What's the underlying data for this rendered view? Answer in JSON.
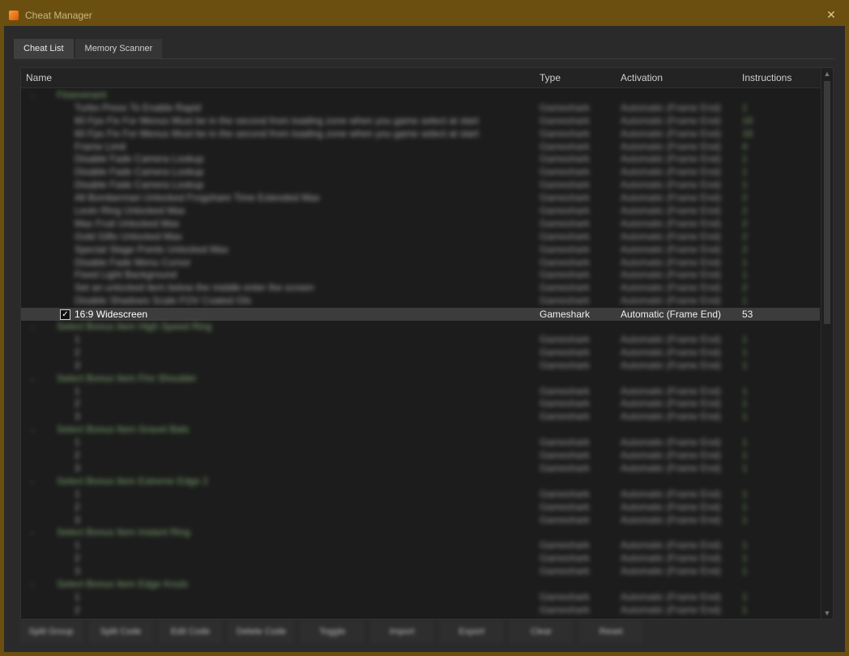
{
  "window": {
    "title": "Cheat Manager"
  },
  "tabs": [
    {
      "label": "Cheat List",
      "active": true
    },
    {
      "label": "Memory Scanner",
      "active": false
    }
  ],
  "columns": {
    "name": "Name",
    "type": "Type",
    "activation": "Activation",
    "instructions": "Instructions"
  },
  "rows": [
    {
      "kind": "group",
      "name": "Flowvenant",
      "type": "",
      "activation": "",
      "instructions": ""
    },
    {
      "kind": "item",
      "name": "Turbo Press To Enable Rapid",
      "type": "Gameshark",
      "activation": "Automatic (Frame End)",
      "instructions": "1"
    },
    {
      "kind": "item",
      "name": "60 Fps Fix For Menus Must be in the second from loading zone when you game select at start",
      "type": "Gameshark",
      "activation": "Automatic (Frame End)",
      "instructions": "16"
    },
    {
      "kind": "item",
      "name": "60 Fps Fix For Menus Must be in the second from loading zone when you game select at start",
      "type": "Gameshark",
      "activation": "Automatic (Frame End)",
      "instructions": "16"
    },
    {
      "kind": "item",
      "name": "Frame Limit",
      "type": "Gameshark",
      "activation": "Automatic (Frame End)",
      "instructions": "4"
    },
    {
      "kind": "item",
      "name": "Disable Fade Camera Lookup",
      "type": "Gameshark",
      "activation": "Automatic (Frame End)",
      "instructions": "1"
    },
    {
      "kind": "item",
      "name": "Disable Fade Camera Lookup",
      "type": "Gameshark",
      "activation": "Automatic (Frame End)",
      "instructions": "1"
    },
    {
      "kind": "item",
      "name": "Disable Fade Camera Lookup",
      "type": "Gameshark",
      "activation": "Automatic (Frame End)",
      "instructions": "1"
    },
    {
      "kind": "item",
      "name": "All Bomberman Unlocked Frogshare Time Extended Max",
      "type": "Gameshark",
      "activation": "Automatic (Frame End)",
      "instructions": "2"
    },
    {
      "kind": "item",
      "name": "Leoin Ring Unlocked Max",
      "type": "Gameshark",
      "activation": "Automatic (Frame End)",
      "instructions": "2"
    },
    {
      "kind": "item",
      "name": "Max Fruit Unlocked Max",
      "type": "Gameshark",
      "activation": "Automatic (Frame End)",
      "instructions": "2"
    },
    {
      "kind": "item",
      "name": "Gold Gifts Unlocked Max",
      "type": "Gameshark",
      "activation": "Automatic (Frame End)",
      "instructions": "2"
    },
    {
      "kind": "item",
      "name": "Special Stage Points Unlocked Max",
      "type": "Gameshark",
      "activation": "Automatic (Frame End)",
      "instructions": "2"
    },
    {
      "kind": "item",
      "name": "Disable Fade Menu Cursor",
      "type": "Gameshark",
      "activation": "Automatic (Frame End)",
      "instructions": "1"
    },
    {
      "kind": "item",
      "name": "Fixed Light Background",
      "type": "Gameshark",
      "activation": "Automatic (Frame End)",
      "instructions": "1"
    },
    {
      "kind": "item",
      "name": "Set an unlocked item below the middle enter the screen",
      "type": "Gameshark",
      "activation": "Automatic (Frame End)",
      "instructions": "2"
    },
    {
      "kind": "item",
      "name": "Disable Shadows Scale FOV Coated Gfx",
      "type": "Gameshark",
      "activation": "Automatic (Frame End)",
      "instructions": "1"
    },
    {
      "kind": "selected",
      "name": "16:9 Widescreen",
      "type": "Gameshark",
      "activation": "Automatic (Frame End)",
      "instructions": "53",
      "checked": true
    },
    {
      "kind": "group",
      "name": "Select Bonus Item High Speed Ring",
      "type": "",
      "activation": "",
      "instructions": ""
    },
    {
      "kind": "item",
      "name": "1",
      "type": "Gameshark",
      "activation": "Automatic (Frame End)",
      "instructions": "1"
    },
    {
      "kind": "item",
      "name": "2",
      "type": "Gameshark",
      "activation": "Automatic (Frame End)",
      "instructions": "1"
    },
    {
      "kind": "item",
      "name": "3",
      "type": "Gameshark",
      "activation": "Automatic (Frame End)",
      "instructions": "1"
    },
    {
      "kind": "group",
      "name": "Select Bonus Item Fire Shoulder",
      "type": "",
      "activation": "",
      "instructions": ""
    },
    {
      "kind": "item",
      "name": "1",
      "type": "Gameshark",
      "activation": "Automatic (Frame End)",
      "instructions": "1"
    },
    {
      "kind": "item",
      "name": "2",
      "type": "Gameshark",
      "activation": "Automatic (Frame End)",
      "instructions": "1"
    },
    {
      "kind": "item",
      "name": "3",
      "type": "Gameshark",
      "activation": "Automatic (Frame End)",
      "instructions": "1"
    },
    {
      "kind": "group",
      "name": "Select Bonus Item Gravel Bats",
      "type": "",
      "activation": "",
      "instructions": ""
    },
    {
      "kind": "item",
      "name": "1",
      "type": "Gameshark",
      "activation": "Automatic (Frame End)",
      "instructions": "1"
    },
    {
      "kind": "item",
      "name": "2",
      "type": "Gameshark",
      "activation": "Automatic (Frame End)",
      "instructions": "1"
    },
    {
      "kind": "item",
      "name": "3",
      "type": "Gameshark",
      "activation": "Automatic (Frame End)",
      "instructions": "1"
    },
    {
      "kind": "group",
      "name": "Select Bonus Item Extreme Edge 2",
      "type": "",
      "activation": "",
      "instructions": ""
    },
    {
      "kind": "item",
      "name": "1",
      "type": "Gameshark",
      "activation": "Automatic (Frame End)",
      "instructions": "1"
    },
    {
      "kind": "item",
      "name": "2",
      "type": "Gameshark",
      "activation": "Automatic (Frame End)",
      "instructions": "1"
    },
    {
      "kind": "item",
      "name": "3",
      "type": "Gameshark",
      "activation": "Automatic (Frame End)",
      "instructions": "1"
    },
    {
      "kind": "group",
      "name": "Select Bonus Item Instant Ring",
      "type": "",
      "activation": "",
      "instructions": ""
    },
    {
      "kind": "item",
      "name": "1",
      "type": "Gameshark",
      "activation": "Automatic (Frame End)",
      "instructions": "1"
    },
    {
      "kind": "item",
      "name": "2",
      "type": "Gameshark",
      "activation": "Automatic (Frame End)",
      "instructions": "1"
    },
    {
      "kind": "item",
      "name": "3",
      "type": "Gameshark",
      "activation": "Automatic (Frame End)",
      "instructions": "1"
    },
    {
      "kind": "group",
      "name": "Select Bonus Item Edge Knuls",
      "type": "",
      "activation": "",
      "instructions": ""
    },
    {
      "kind": "item",
      "name": "1",
      "type": "Gameshark",
      "activation": "Automatic (Frame End)",
      "instructions": "1"
    },
    {
      "kind": "item",
      "name": "2",
      "type": "Gameshark",
      "activation": "Automatic (Frame End)",
      "instructions": "1"
    }
  ],
  "buttons": [
    "Split Group",
    "Split Code",
    "Edit Code",
    "Delete Code",
    "Toggle",
    "Import",
    "Export",
    "Clear",
    "Reset"
  ],
  "colors": {
    "accent": "#6b4f10",
    "group_text": "#9ad08a",
    "instruction_text": "#8ec27a"
  }
}
